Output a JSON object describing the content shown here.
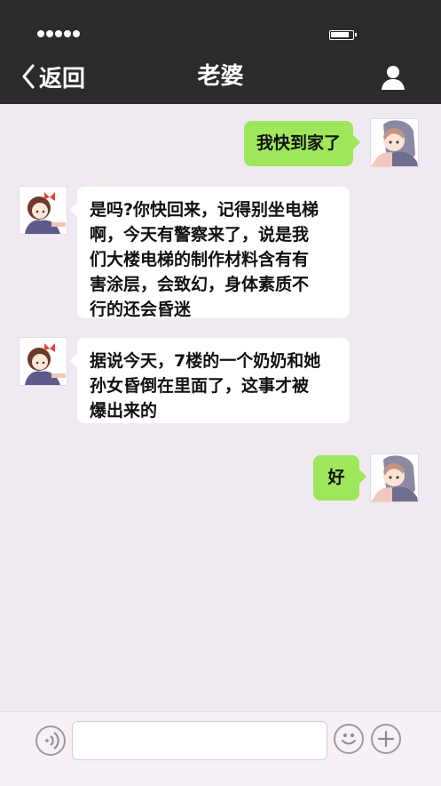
{
  "header": {
    "back_label": "返回",
    "title": "老婆"
  },
  "messages": [
    {
      "side": "right",
      "text": "我快到家了"
    },
    {
      "side": "left",
      "lines": [
        "是吗?你快回来，记得别坐电梯",
        "啊，今天有警察来了，说是我",
        "们大楼电梯的制作材料含有有",
        "害涂层，会致幻，身体素质不",
        "行的还会昏迷"
      ]
    },
    {
      "side": "left",
      "lines": [
        "据说今天，7楼的一个奶奶和她",
        "孙女昏倒在里面了，这事才被",
        "爆出来的"
      ]
    },
    {
      "side": "right",
      "text": "好"
    }
  ],
  "input": {
    "value": "",
    "placeholder": ""
  },
  "colors": {
    "header_bg": "#2b2b2d",
    "chat_bg": "#f1e9f2",
    "sent_bubble": "#9ee75a",
    "received_bubble": "#ffffff"
  },
  "icons": [
    "signal-dots-icon",
    "battery-icon",
    "back-chevron-icon",
    "profile-icon",
    "voice-icon",
    "emoji-icon",
    "plus-icon"
  ]
}
